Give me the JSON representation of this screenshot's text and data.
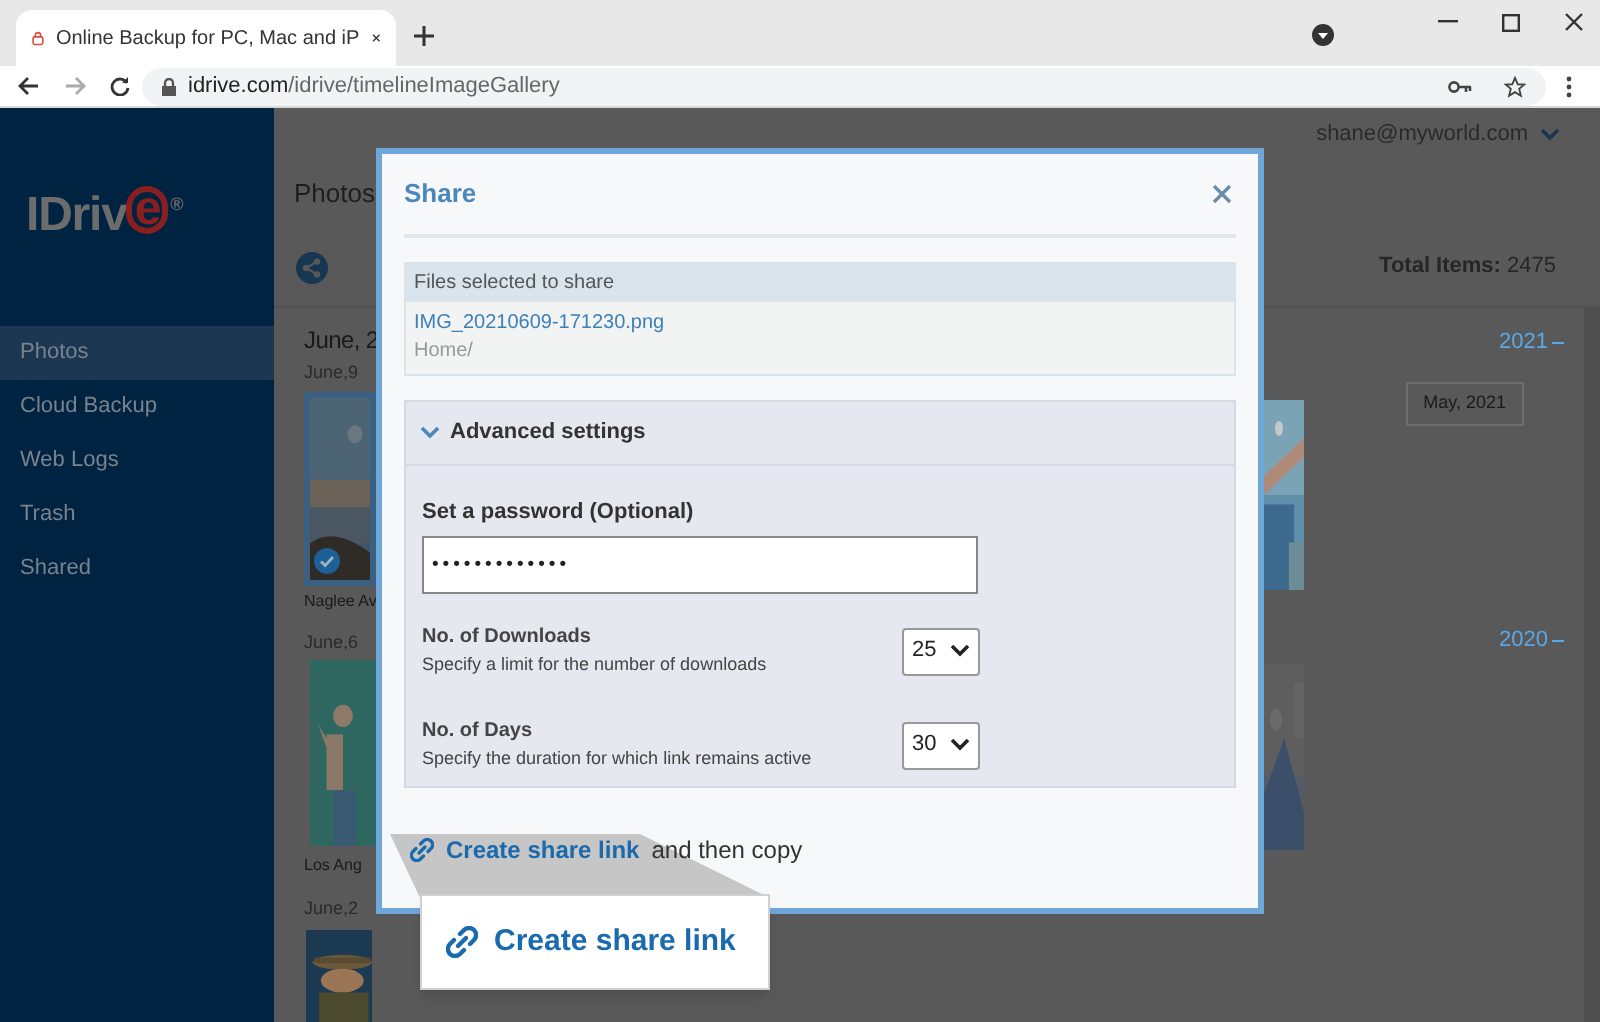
{
  "browser": {
    "tab_title": "Online Backup for PC, Mac and iP",
    "url_domain": "idrive.com",
    "url_path": "/idrive/timelineImageGallery"
  },
  "app": {
    "logo_text": "IDriv",
    "logo_accent": "e",
    "logo_mark": "®",
    "sidebar": [
      {
        "label": "Photos",
        "selected": true
      },
      {
        "label": "Cloud Backup",
        "selected": false
      },
      {
        "label": "Web Logs",
        "selected": false
      },
      {
        "label": "Trash",
        "selected": false
      },
      {
        "label": "Shared",
        "selected": false
      }
    ],
    "user": "shane@myworld.com",
    "page_title": "Photos",
    "total_label": "Total Items:",
    "total_value": "2475",
    "month_heading": "June, 2",
    "groups": [
      {
        "date": "June,9",
        "caption": "Naglee Av",
        "checked": true
      },
      {
        "date": "June,6",
        "caption": "Los Ang",
        "checked": false
      },
      {
        "date": "June,2",
        "checked": false
      }
    ],
    "timeline": [
      {
        "kind": "year",
        "label": "2021"
      },
      {
        "kind": "month",
        "label": "May, 2021"
      },
      {
        "kind": "year",
        "label": "2020"
      }
    ]
  },
  "dialog": {
    "title": "Share",
    "files_heading": "Files selected to share",
    "file_name": "IMG_20210609-171230.png",
    "file_path": "Home/",
    "advanced": {
      "label": "Advanced settings",
      "expanded": true
    },
    "password_label": "Set a password (Optional)",
    "password_value": "•••••••••••••",
    "settings": [
      {
        "title": "No. of Downloads",
        "description": "Specify a limit for the number of downloads",
        "value": "25"
      },
      {
        "title": "No. of Days",
        "description": "Specify the duration for which link remains active",
        "value": "30"
      }
    ],
    "link_label": "Create share link",
    "link_suffix": "and then copy"
  },
  "callout": {
    "label": "Create share link"
  }
}
